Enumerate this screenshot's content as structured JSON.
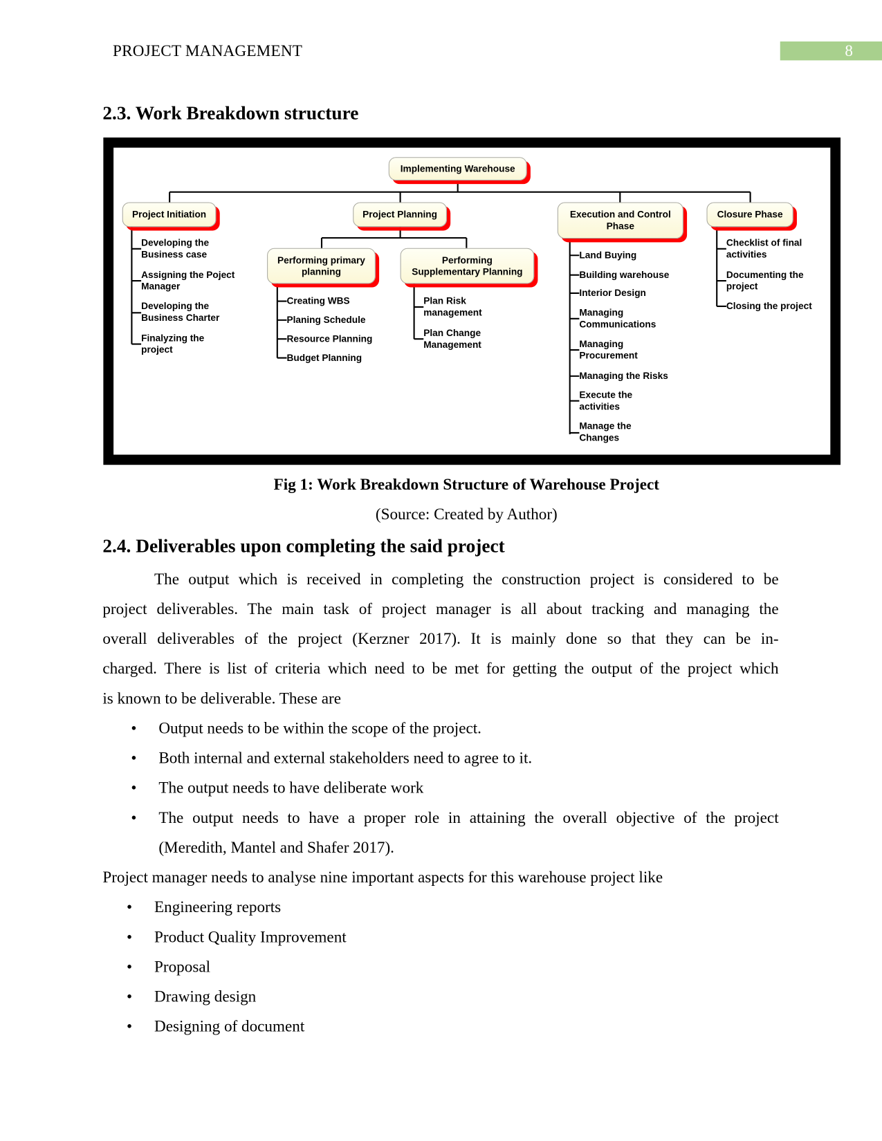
{
  "header": {
    "running_title": "PROJECT MANAGEMENT",
    "page_number": "8",
    "page_badge_color": "#a8d08d"
  },
  "section_23": {
    "heading": "2.3. Work Breakdown structure"
  },
  "wbs": {
    "root": "Implementing Warehouse",
    "box_fill": "#fdfbe3",
    "box_shadow_color": "#ff0000",
    "phases": [
      {
        "label": "Project Initiation",
        "items": [
          "Developing the\nBusiness case",
          "Assigning the Poject\nManager",
          "Developing the\nBusiness Charter",
          "Finalyzing the\nproject"
        ]
      },
      {
        "label": "Project Planning",
        "subphases": [
          {
            "label": "Performing primary\nplanning",
            "items": [
              "Creating WBS",
              "Planing Schedule",
              "Resource Planning",
              "Budget Planning"
            ]
          },
          {
            "label": "Performing\nSupplementary Planning",
            "items": [
              "Plan Risk\nmanagement",
              "Plan Change\nManagement"
            ]
          }
        ]
      },
      {
        "label": "Execution and Control\nPhase",
        "items": [
          "Land Buying",
          "Building warehouse",
          "Interior Design",
          "Managing\nCommunications",
          "Managing\nProcurement",
          "Managing the Risks",
          "Execute the\nactivities",
          "Manage the\nChanges"
        ]
      },
      {
        "label": "Closure Phase",
        "items": [
          "Checklist of final\nactivities",
          "Documenting the\nproject",
          "Closing the project"
        ]
      }
    ]
  },
  "figure": {
    "caption": "Fig 1: Work Breakdown Structure of Warehouse Project",
    "source": "(Source: Created by Author)"
  },
  "section_24": {
    "heading": "2.4. Deliverables upon completing the said project",
    "paragraph_lines": [
      "The output which is received in completing the construction project is considered to be",
      "project deliverables. The main task of project manager is all about tracking and managing the",
      "overall deliverables of the project (Kerzner 2017). It is mainly done so that they can be in-",
      "charged. There is list of criteria which need to be met for getting the output of the project which",
      "is known to be deliverable. These are"
    ],
    "criteria": [
      "Output needs to be within the scope of the project.",
      "Both internal and external stakeholders need to agree to it.",
      "The output needs to have deliberate work",
      "The output needs to have a proper role in attaining the overall objective of the project",
      "(Meredith, Mantel and Shafer 2017)."
    ],
    "aspects_intro": "Project manager needs to analyse nine important aspects for this warehouse project like",
    "aspects": [
      "Engineering reports",
      "Product Quality Improvement",
      "Proposal",
      "Drawing design",
      "Designing of document"
    ]
  }
}
